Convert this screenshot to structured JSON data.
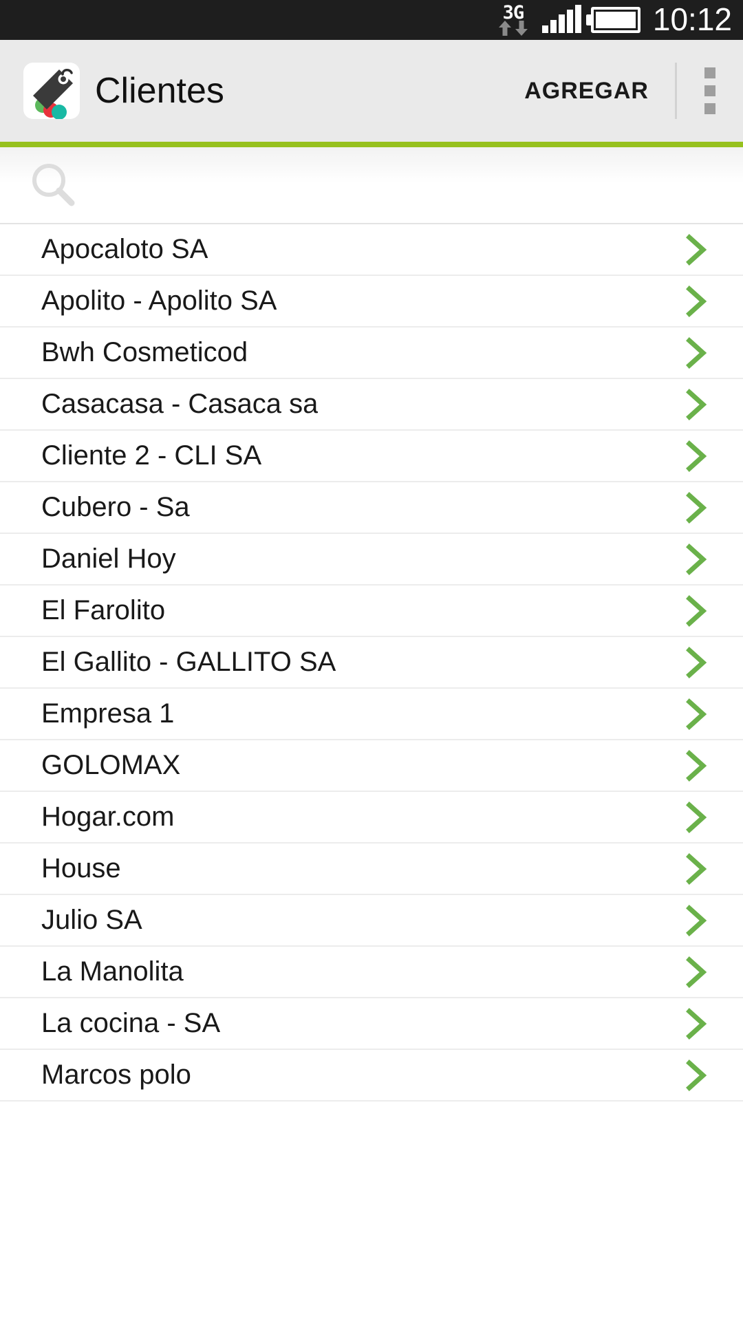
{
  "statusbar": {
    "network_label": "3G",
    "network_icon": "3g-data-icon",
    "data_up_icon": "arrow-up-icon",
    "data_down_icon": "arrow-down-icon",
    "signal_icon": "signal-bars-icon",
    "signal_bars": 5,
    "battery_icon": "battery-full-icon",
    "battery_level": 100,
    "time": "10:12",
    "background_color": "#1e1e1e"
  },
  "appbar": {
    "app_icon": "price-tag-icon",
    "title": "Clientes",
    "action_label": "AGREGAR",
    "overflow_icon": "overflow-menu-icon",
    "background_color": "#eaeaea",
    "accent_color": "#96c11e"
  },
  "search": {
    "icon": "magnifier-icon",
    "value": "",
    "placeholder": ""
  },
  "list": {
    "chevron_icon": "chevron-right-icon",
    "chevron_color": "#6ab14a",
    "items": [
      {
        "label": "Apocaloto SA"
      },
      {
        "label": "Apolito - Apolito SA"
      },
      {
        "label": "Bwh Cosmeticod"
      },
      {
        "label": "Casacasa - Casaca sa"
      },
      {
        "label": "Cliente 2 - CLI SA"
      },
      {
        "label": "Cubero - Sa"
      },
      {
        "label": "Daniel Hoy"
      },
      {
        "label": "El Farolito"
      },
      {
        "label": "El Gallito - GALLITO SA"
      },
      {
        "label": "Empresa 1"
      },
      {
        "label": "GOLOMAX"
      },
      {
        "label": "Hogar.com"
      },
      {
        "label": "House"
      },
      {
        "label": "Julio SA"
      },
      {
        "label": "La Manolita"
      },
      {
        "label": "La cocina - SA"
      },
      {
        "label": "Marcos polo"
      }
    ]
  }
}
